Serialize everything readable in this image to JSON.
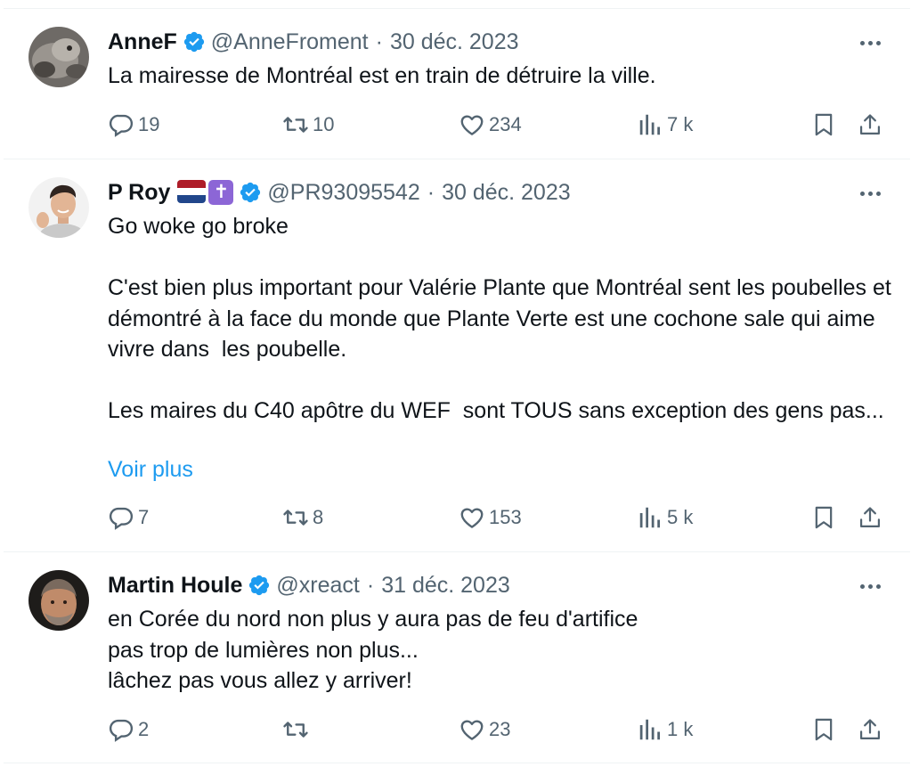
{
  "colors": {
    "accent": "#1d9bf0",
    "muted": "#536471",
    "text": "#0f1419",
    "divider": "#eff3f4"
  },
  "tweets": [
    {
      "name": "AnneF",
      "handle": "@AnneFroment",
      "separator": "·",
      "date": "30 déc. 2023",
      "text": "La mairesse de Montréal est en train de détruire la ville.",
      "replies": "19",
      "retweets": "10",
      "likes": "234",
      "views": "7 k"
    },
    {
      "name": "P Roy",
      "flag_emoji": "🇳🇱",
      "cross_symbol": "✝",
      "handle": "@PR93095542",
      "separator": "·",
      "date": "30 déc. 2023",
      "text": "Go woke go broke\n\nC'est bien plus important pour Valérie Plante que Montréal sent les poubelles et démontré à la face du monde que Plante Verte est une cochone sale qui aime vivre dans  les poubelle.\n\nLes maires du C40 apôtre du WEF  sont TOUS sans exception des gens pas...",
      "show_more": "Voir plus",
      "replies": "7",
      "retweets": "8",
      "likes": "153",
      "views": "5 k"
    },
    {
      "name": "Martin Houle",
      "handle": "@xreact",
      "separator": "·",
      "date": "31 déc. 2023",
      "text": "en Corée du nord non plus y aura pas de feu d'artifice\npas trop de lumières non plus...\nlâchez pas vous allez y arriver!",
      "replies": "2",
      "retweets": "",
      "likes": "23",
      "views": "1 k"
    }
  ]
}
